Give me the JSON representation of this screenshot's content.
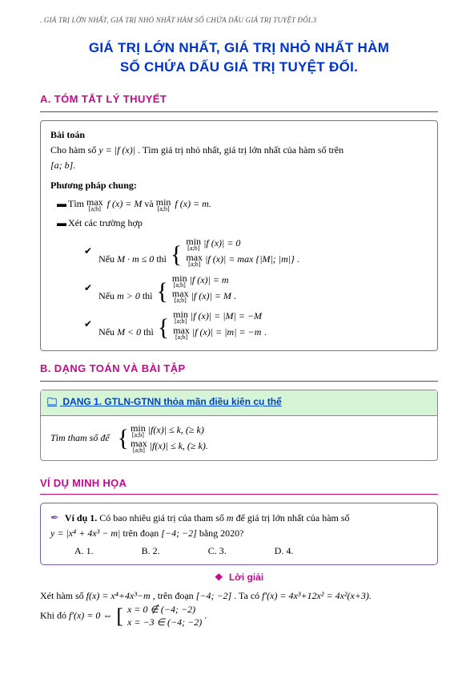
{
  "header": ". GIÁ TRỊ LỚN NHẤT, GIÁ TRỊ NHỎ NHẤT HÀM SỐ CHỨA DẤU GIÁ TRỊ TUYỆT ĐỐI.3",
  "title_line1": "GIÁ TRỊ LỚN NHẤT, GIÁ TRỊ NHỎ NHẤT HÀM",
  "title_line2": "SỐ CHỨA DẤU GIÁ TRỊ TUYỆT ĐỐI.",
  "secA_label": "A.    TÓM TẮT LÝ THUYẾT",
  "theory": {
    "bt": "Bài toán",
    "bt_text1": "Cho hàm số ",
    "bt_math": "y = |f (x)|",
    "bt_text2": ". Tìm giá trị nhỏ nhất, giá trị lớn nhất của hàm số trên",
    "bt_text3": "[a; b].",
    "method": "Phương pháp chung:",
    "l1a": "Tìm ",
    "l1b": " và ",
    "l1_max": "max",
    "l1_min": "min",
    "l1_ab": "[a;b]",
    "l1_fx_M": "f (x) = M",
    "l1_fx_m": "f (x) = m.",
    "l2": "Xét các trường hợp",
    "c1_label": "Nếu ",
    "c1_cond": "M · m ≤ 0",
    "c1_then": " thì ",
    "c1_r1a": "|f (x)| = 0",
    "c1_r2a": "|f (x)| = max {|M|; |m|}",
    "c2_cond": "m > 0",
    "c2_r1": "|f (x)| = m",
    "c2_r2": "|f (x)| = M",
    "c3_cond": "M < 0",
    "c3_r1": "|f (x)| = |M| = −M",
    "c3_r2": "|f (x)| = |m| = −m",
    "dot": "."
  },
  "secB_label": "B.    DẠNG TOÁN VÀ BÀI TẬP",
  "dang": {
    "title": "DẠNG 1. GTLN-GTNN thỏa mãn điều kiện cụ thể",
    "body_label": "Tìm tham số để",
    "r1": "|f(x)| ≤ k, (≥ k)",
    "r2": "|f(x)| ≤ k, (≥ k).",
    "min": "min",
    "max": "max",
    "ab": "[a;b]"
  },
  "vd_title": "VÍ DỤ MINH HỌA",
  "ex": {
    "label": "Ví dụ 1.",
    "q1": " Có bao nhiêu giá trị của tham số ",
    "q_m": "m",
    "q2": " để giá trị lớn nhất của hàm số",
    "q3a": "y = |x⁴ + 4x³ − m|",
    "q3b": " trên đoạn ",
    "q3c": "[−4; −2]",
    "q3d": " bằng 2020?",
    "A": "A. 1.",
    "B": "B. 2.",
    "C": "C. 3.",
    "D": "D. 4."
  },
  "sol": {
    "head": "Lời giải",
    "l1a": "Xét hàm số ",
    "l1b": "f(x) = x⁴+4x³−m",
    "l1c": ", trên đoạn ",
    "l1d": "[−4; −2]",
    "l1e": ". Ta có ",
    "l1f": "f′(x) = 4x³+12x² = 4x²(x+3).",
    "l2a": "Khi đó ",
    "l2b": "f′(x) = 0 ⇔ ",
    "l2c1": "x = 0 ∉ (−4; −2)",
    "l2c2": "x = −3 ∈ (−4; −2)",
    "l2d": "."
  }
}
